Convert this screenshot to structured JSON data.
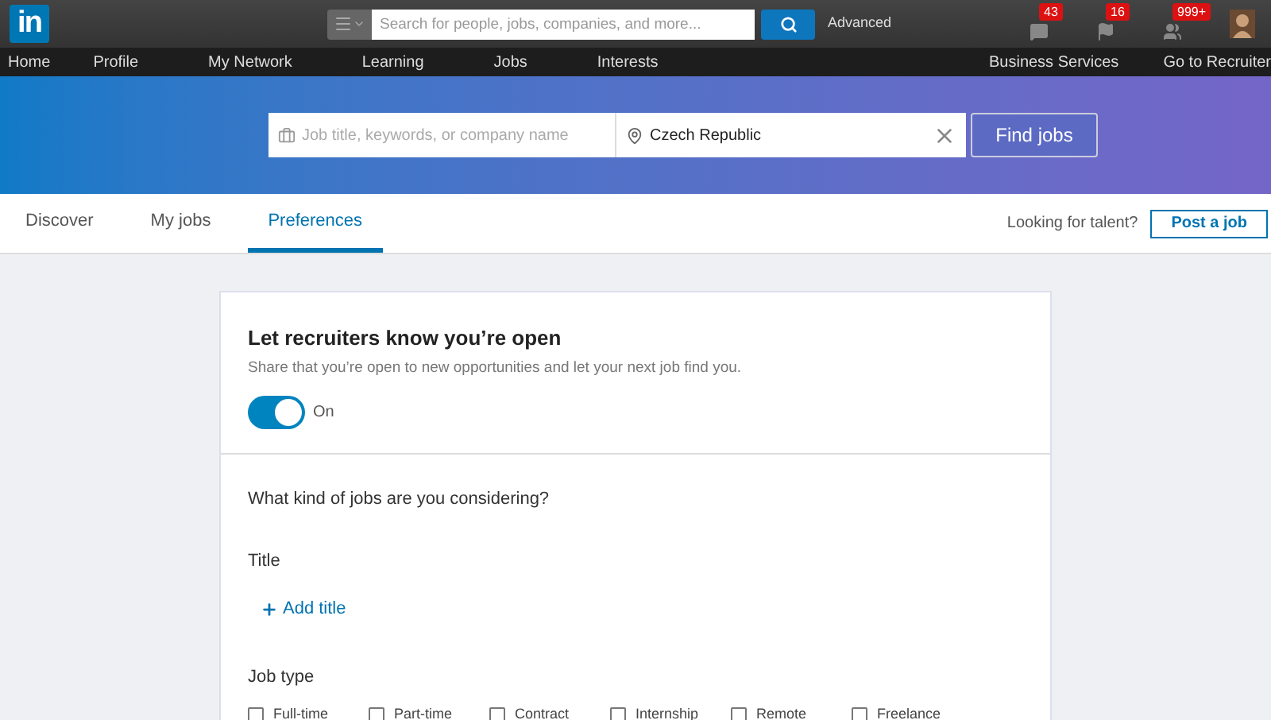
{
  "logo": {
    "text": "in"
  },
  "search": {
    "placeholder": "Search for people, jobs, companies, and more...",
    "advanced": "Advanced"
  },
  "notifications": [
    {
      "kind": "messages",
      "count": "43"
    },
    {
      "kind": "flags",
      "count": "16"
    },
    {
      "kind": "people",
      "count": "999+"
    }
  ],
  "nav": {
    "left": [
      "Home",
      "Profile",
      "My Network",
      "Learning",
      "Jobs",
      "Interests"
    ],
    "right": [
      "Business Services",
      "Go to Recruiter"
    ]
  },
  "job_search": {
    "keywords_placeholder": "Job title, keywords, or company name",
    "location": "Czech Republic",
    "button": "Find jobs"
  },
  "tabs": [
    {
      "label": "Discover",
      "selected": false
    },
    {
      "label": "My jobs",
      "selected": false
    },
    {
      "label": "Preferences",
      "selected": true
    }
  ],
  "talent": {
    "text": "Looking for talent?",
    "button": "Post a job"
  },
  "open_card": {
    "title": "Let recruiters know you’re open",
    "description": "Share that you’re open to new opportunities and let your next job find you.",
    "toggle": {
      "on": true,
      "label": "On"
    }
  },
  "preferences": {
    "question": "What kind of jobs are you considering?",
    "title_label": "Title",
    "add_title": "Add title",
    "job_type_label": "Job type",
    "job_types": [
      {
        "label": "Full-time",
        "checked": false
      },
      {
        "label": "Part-time",
        "checked": false
      },
      {
        "label": "Contract",
        "checked": false
      },
      {
        "label": "Internship",
        "checked": false
      },
      {
        "label": "Remote",
        "checked": false
      },
      {
        "label": "Freelance",
        "checked": false
      }
    ]
  }
}
